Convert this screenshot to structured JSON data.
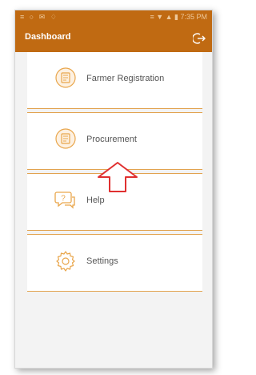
{
  "statusbar": {
    "left_icons": "≡ ○ ✉ ♢",
    "right_text": "≡ ▼ ▲ ▮ 7:35 PM"
  },
  "appbar": {
    "title": "Dashboard",
    "logout_icon": "logout-icon"
  },
  "menu": {
    "items": [
      {
        "label": "Farmer Registration",
        "icon": "farmer-registration-icon"
      },
      {
        "label": "Procurement",
        "icon": "procurement-icon"
      },
      {
        "label": "Help",
        "icon": "help-icon"
      },
      {
        "label": "Settings",
        "icon": "settings-icon"
      }
    ]
  },
  "annotation": {
    "arrow_color": "#e03030"
  },
  "colors": {
    "brand": "#c06a12",
    "divider": "#e2a34f",
    "icon": "#e9a64c"
  }
}
